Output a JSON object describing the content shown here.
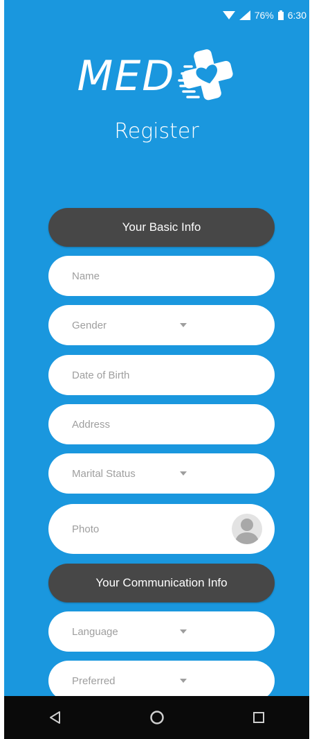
{
  "status_bar": {
    "battery_percent": "76%",
    "time": "6:30"
  },
  "brand": {
    "logo_text": "MED"
  },
  "page": {
    "title": "Register"
  },
  "sections": {
    "basic_info": "Your Basic Info",
    "communication_info": "Your Communication Info"
  },
  "fields": {
    "name": "Name",
    "gender": "Gender",
    "dob": "Date of Birth",
    "address": "Address",
    "marital_status": "Marital Status",
    "photo": "Photo",
    "language": "Language",
    "preferred": "Preferred"
  },
  "colors": {
    "background": "#1a97de",
    "section_header": "#474747",
    "field_bg": "#ffffff",
    "placeholder": "#9e9e9e",
    "nav_bar": "#0a0a0a"
  }
}
